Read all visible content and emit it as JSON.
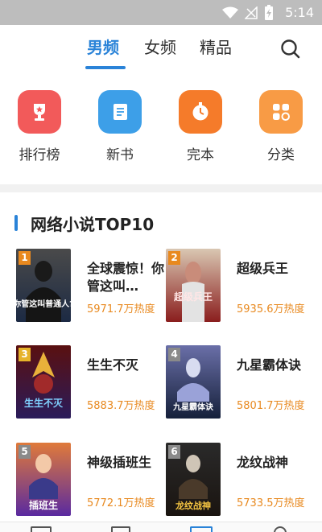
{
  "status_bar": {
    "time": "5:14"
  },
  "tabs": [
    {
      "label": "男频",
      "active": true
    },
    {
      "label": "女频",
      "active": false
    },
    {
      "label": "精品",
      "active": false
    }
  ],
  "quick_nav": [
    {
      "label": "排行榜",
      "icon": "trophy-icon",
      "color": "#f25a5a"
    },
    {
      "label": "新书",
      "icon": "scroll-icon",
      "color": "#3d9fe8"
    },
    {
      "label": "完本",
      "icon": "stopwatch-icon",
      "color": "#f57b2a"
    },
    {
      "label": "分类",
      "icon": "grid-icon",
      "color": "#f89b45"
    }
  ],
  "section": {
    "title": "网络小说TOP10"
  },
  "books": [
    {
      "rank": "1",
      "title": "全球震惊！你管这叫…",
      "hot": "5971.7万热度",
      "rank_color": "#e8891f",
      "cover_top": "#4a4a4a",
      "cover_bottom": "#1c2a44",
      "cover_text": "你管这叫普通人?"
    },
    {
      "rank": "2",
      "title": "超级兵王",
      "hot": "5935.6万热度",
      "rank_color": "#e8891f",
      "cover_top": "#d9c7b2",
      "cover_bottom": "#8a1d1d",
      "cover_text": "超级兵王"
    },
    {
      "rank": "3",
      "title": "生生不灭",
      "hot": "5883.7万热度",
      "rank_color": "#e6b32a",
      "cover_top": "#5a1010",
      "cover_bottom": "#2a1b5a",
      "cover_text": "生生不灭"
    },
    {
      "rank": "4",
      "title": "九星霸体诀",
      "hot": "5801.7万热度",
      "rank_color": "#8a8a8a",
      "cover_top": "#6a6fa8",
      "cover_bottom": "#15203a",
      "cover_text": "九星霸体诀"
    },
    {
      "rank": "5",
      "title": "神级插班生",
      "hot": "5772.1万热度",
      "rank_color": "#8a8a8a",
      "cover_top": "#e07a3a",
      "cover_bottom": "#5a2aa0",
      "cover_text": "插班生"
    },
    {
      "rank": "6",
      "title": "龙纹战神",
      "hot": "5733.5万热度",
      "rank_color": "#8a8a8a",
      "cover_top": "#2a2a2a",
      "cover_bottom": "#1a1410",
      "cover_text": "龙纹战神"
    }
  ]
}
